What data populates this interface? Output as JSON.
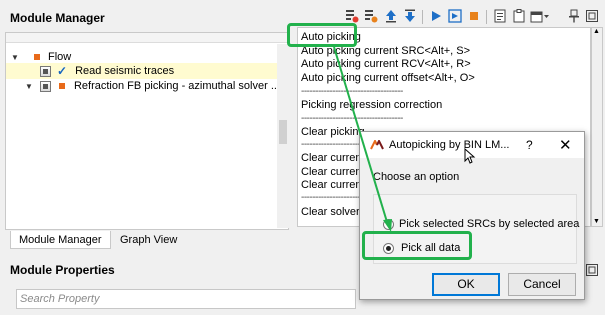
{
  "header": {
    "title": "Module Manager"
  },
  "toolbar": {
    "icons": [
      "list-remove-icon",
      "list-refresh-icon",
      "move-up-icon",
      "move-down-icon",
      "run-icon",
      "run-step-icon",
      "stop-icon",
      "notes-icon",
      "clipboard-icon",
      "layout-icon",
      "pin-icon",
      "detach-icon"
    ]
  },
  "tree": {
    "root": {
      "label": "Flow"
    },
    "items": [
      {
        "label": "Read seismic traces"
      },
      {
        "label": "Refraction FB picking - azimuthal solver ..."
      }
    ]
  },
  "tabs": [
    {
      "label": "Module Manager"
    },
    {
      "label": "Graph View"
    }
  ],
  "menu": {
    "auto_picking": "Auto picking",
    "items": [
      "Auto picking current SRC<Alt+, S>",
      "Auto picking current RCV<Alt+, R>",
      "Auto picking current offset<Alt+, O>"
    ],
    "divider": "------------------------------------",
    "regression": "Picking regression correction",
    "clear_picking": "Clear picking",
    "clear_current": [
      "Clear current",
      "Clear current",
      "Clear current"
    ],
    "clear_solvers": "Clear solvers"
  },
  "properties": {
    "title": "Module Properties",
    "search_placeholder": "Search Property"
  },
  "dialog": {
    "title": "Autopicking by BIN LM...",
    "help": "?",
    "close": "✕",
    "prompt": "Choose an option",
    "options": [
      {
        "label": "Pick selected SRCs by selected area",
        "selected": false
      },
      {
        "label": "Pick all data",
        "selected": true
      }
    ],
    "ok": "OK",
    "cancel": "Cancel"
  },
  "colors": {
    "highlight": "#22b14c",
    "flow_marker": "#e86a1a",
    "check_blue": "#1565c0"
  }
}
